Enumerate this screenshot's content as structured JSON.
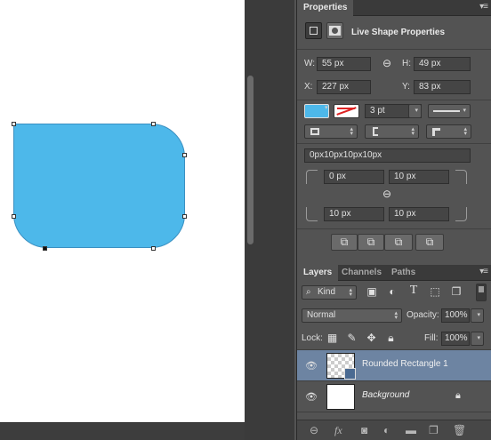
{
  "canvas": {
    "shape_color": "#4db8ea"
  },
  "properties": {
    "tab": "Properties",
    "heading": "Live Shape Properties",
    "w_label": "W:",
    "w_value": "55 px",
    "h_label": "H:",
    "h_value": "49 px",
    "x_label": "X:",
    "x_value": "227 px",
    "y_label": "Y:",
    "y_value": "83 px",
    "fill_color": "#4db8ea",
    "stroke_width": "3 pt",
    "radius_summary": "0px10px10px10px",
    "radius_tl": "0 px",
    "radius_tr": "10 px",
    "radius_bl": "10 px",
    "radius_br": "10 px"
  },
  "layers_panel": {
    "tabs": [
      "Layers",
      "Channels",
      "Paths"
    ],
    "filter_kind": "Kind",
    "blend_mode": "Normal",
    "opacity_label": "Opacity:",
    "opacity_value": "100%",
    "lock_label": "Lock:",
    "fill_label": "Fill:",
    "fill_value": "100%",
    "layers": [
      {
        "name": "Rounded Rectangle 1",
        "selected": true
      },
      {
        "name": "Background",
        "locked": true
      }
    ]
  }
}
